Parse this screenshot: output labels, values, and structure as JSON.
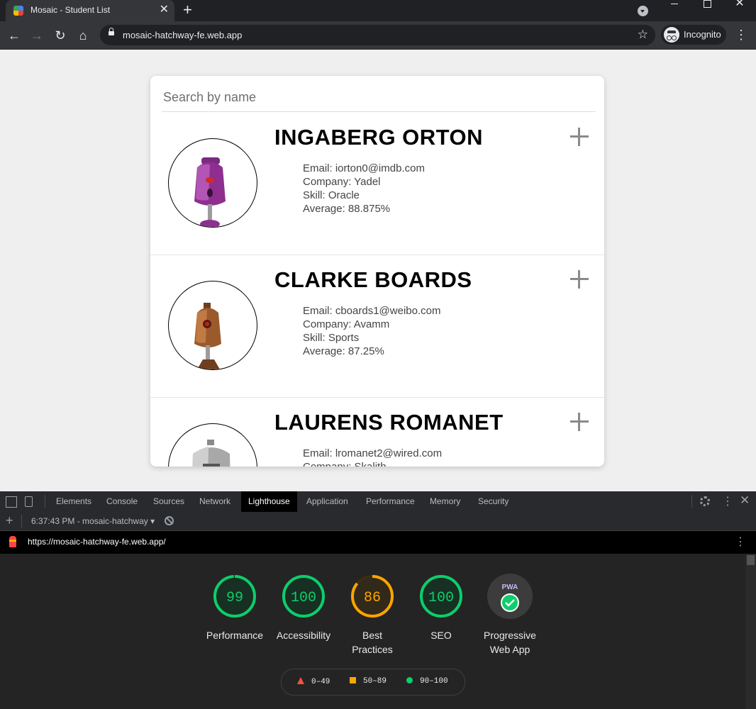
{
  "browser": {
    "tab_title": "Mosaic - Student List",
    "tab_close": "✕",
    "new_tab": "+",
    "url": "mosaic-hatchway-fe.web.app",
    "profile_label": "Incognito"
  },
  "search": {
    "placeholder": "Search by name"
  },
  "students": [
    {
      "name": "INGABERG ORTON",
      "email": "Email: iorton0@imdb.com",
      "company": "Company: Yadel",
      "skill": "Skill: Oracle",
      "average": "Average: 88.875%",
      "avatar_color": "#8e2f8f"
    },
    {
      "name": "CLARKE BOARDS",
      "email": "Email: cboards1@weibo.com",
      "company": "Company: Avamm",
      "skill": "Skill: Sports",
      "average": "Average: 87.25%",
      "avatar_color": "#9a5a2c"
    },
    {
      "name": "LAURENS ROMANET",
      "email": "Email: lromanet2@wired.com",
      "company": "Company: Skalith",
      "skill": "",
      "average": "",
      "avatar_color": "#9a9a9a"
    }
  ],
  "devtools": {
    "tabs": [
      "Elements",
      "Console",
      "Sources",
      "Network",
      "Lighthouse",
      "Application",
      "Performance",
      "Memory",
      "Security"
    ],
    "active_tab": "Lighthouse",
    "report_label": "6:37:43 PM - mosaic-hatchway",
    "report_url": "https://mosaic-hatchway-fe.web.app/"
  },
  "lighthouse": {
    "scores": [
      {
        "label": "Performance",
        "value": "99",
        "fraction": 0.99,
        "color": "#0cce6b",
        "bg": "#0c3a22"
      },
      {
        "label": "Accessibility",
        "value": "100",
        "fraction": 1.0,
        "color": "#0cce6b",
        "bg": "#0c3a22"
      },
      {
        "label": "Best Practices",
        "value": "86",
        "fraction": 0.86,
        "color": "#ffa400",
        "bg": "#3e2d10"
      },
      {
        "label": "SEO",
        "value": "100",
        "fraction": 1.0,
        "color": "#0cce6b",
        "bg": "#0c3a22"
      }
    ],
    "pwa": {
      "label": "Progressive Web App",
      "badge": "PWA"
    },
    "legend": [
      {
        "range": "0–49",
        "color": "#ff4e42",
        "shape": "triangle"
      },
      {
        "range": "50–89",
        "color": "#ffa400",
        "shape": "square"
      },
      {
        "range": "90–100",
        "color": "#0cce6b",
        "shape": "circle"
      }
    ]
  }
}
